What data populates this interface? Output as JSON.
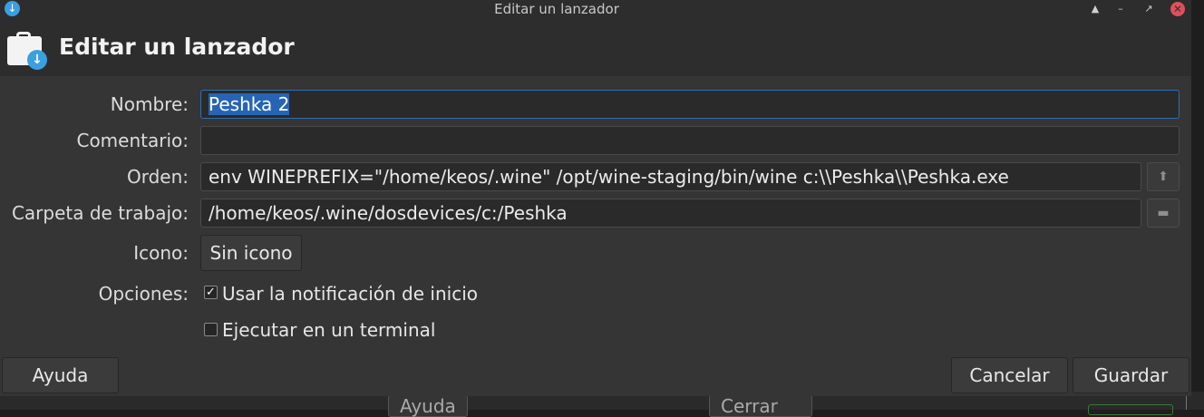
{
  "titlebar": {
    "title": "Editar un lanzador",
    "minimize_glyph": "▲",
    "maximize_glyph": "–",
    "restore_glyph": "↗",
    "close_glyph": "✕"
  },
  "header": {
    "title": "Editar un lanzador"
  },
  "form": {
    "name_label": "Nombre:",
    "name_selected": "Peshka 2",
    "comment_label": "Comentario:",
    "comment_value": "",
    "command_label": "Orden:",
    "command_value": "env WINEPREFIX=\"/home/keos/.wine\" /opt/wine-staging/bin/wine c:\\\\Peshka\\\\Peshka.exe",
    "workdir_label": "Carpeta de trabajo:",
    "workdir_value": "/home/keos/.wine/dosdevices/c:/Peshka",
    "icon_label": "Icono:",
    "icon_button": "Sin icono",
    "options_label": "Opciones:",
    "option_startup_notification": "Usar la notificación de inicio",
    "option_startup_checked": true,
    "option_terminal": "Ejecutar en un terminal",
    "option_terminal_checked": false
  },
  "buttons": {
    "help": "Ayuda",
    "cancel": "Cancelar",
    "save": "Guardar"
  },
  "background_window": {
    "help": "Ayuda",
    "close": "Cerrar"
  },
  "icons": {
    "app": "download-icon",
    "header": "launcher-bag-icon",
    "command_browse": "upload-icon",
    "folder_browse": "folder-icon"
  },
  "colors": {
    "selection": "#2864b4",
    "accent": "#3aa0e0",
    "close": "#e0505a"
  }
}
